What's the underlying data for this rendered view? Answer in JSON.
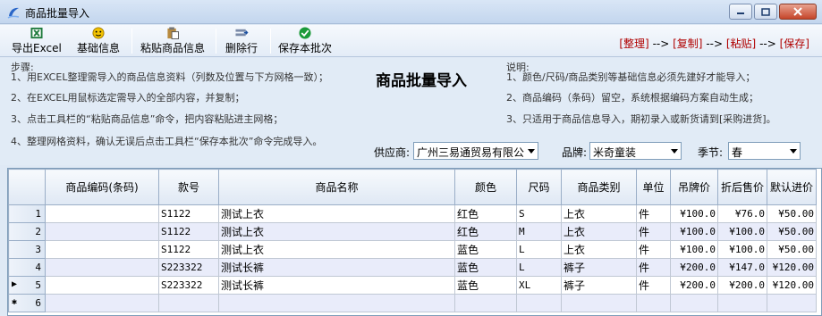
{
  "window": {
    "title": "商品批量导入"
  },
  "toolbar": {
    "items": [
      {
        "label": "导出Excel",
        "icon": "excel-icon"
      },
      {
        "label": "基础信息",
        "icon": "smiley-icon"
      },
      {
        "label": "粘贴商品信息",
        "icon": "paste-icon"
      },
      {
        "label": "删除行",
        "icon": "delete-row-icon"
      },
      {
        "label": "保存本批次",
        "icon": "check-icon"
      }
    ],
    "workflow": [
      "[整理]",
      "-->",
      "[复制]",
      "-->",
      "[粘贴]",
      "-->",
      "[保存]"
    ]
  },
  "steps": {
    "title": "步骤:",
    "items": [
      "1、用EXCEL整理需导入的商品信息资料（列数及位置与下方网格一致）；",
      "2、在EXCEL用鼠标选定需导入的全部内容，并复制；",
      "3、点击工具栏的“粘贴商品信息”命令，把内容粘贴进主网格；",
      "4、整理网格资料，确认无误后点击工具栏“保存本批次”命令完成导入。"
    ]
  },
  "heading": "商品批量导入",
  "notes": {
    "title": "说明:",
    "items": [
      "1、颜色/尺码/商品类别等基础信息必须先建好才能导入；",
      "2、商品编码（条码）留空，系统根据编码方案自动生成；",
      "3、只适用于商品信息导入，期初录入或新货请到[采购进货]。"
    ]
  },
  "filters": {
    "supplier": {
      "label": "供应商:",
      "value": "广州三易通贸易有限公"
    },
    "brand": {
      "label": "品牌:",
      "value": "米奇童装"
    },
    "season": {
      "label": "季节:",
      "value": "春"
    }
  },
  "grid": {
    "columns": [
      "商品编码(条码)",
      "款号",
      "商品名称",
      "颜色",
      "尺码",
      "商品类别",
      "单位",
      "吊牌价",
      "折后售价",
      "默认进价"
    ],
    "rows": [
      {
        "num": "1",
        "code": "",
        "style": "S1122",
        "name": "测试上衣",
        "color": "红色",
        "size": "S",
        "category": "上衣",
        "unit": "件",
        "tag": "¥100.0",
        "sale": "¥76.0",
        "cost": "¥50.00"
      },
      {
        "num": "2",
        "code": "",
        "style": "S1122",
        "name": "测试上衣",
        "color": "红色",
        "size": "M",
        "category": "上衣",
        "unit": "件",
        "tag": "¥100.0",
        "sale": "¥100.0",
        "cost": "¥50.00"
      },
      {
        "num": "3",
        "code": "",
        "style": "S1122",
        "name": "测试上衣",
        "color": "蓝色",
        "size": "L",
        "category": "上衣",
        "unit": "件",
        "tag": "¥100.0",
        "sale": "¥100.0",
        "cost": "¥50.00"
      },
      {
        "num": "4",
        "code": "",
        "style": "S223322",
        "name": "测试长裤",
        "color": "蓝色",
        "size": "L",
        "category": "裤子",
        "unit": "件",
        "tag": "¥200.0",
        "sale": "¥147.0",
        "cost": "¥120.00"
      },
      {
        "num": "5",
        "code": "",
        "style": "S223322",
        "name": "测试长裤",
        "color": "蓝色",
        "size": "XL",
        "category": "裤子",
        "unit": "件",
        "tag": "¥200.0",
        "sale": "¥200.0",
        "cost": "¥120.00"
      }
    ],
    "new_row": {
      "num": "6"
    },
    "markers": {
      "current": "▶",
      "new": "✱"
    }
  }
}
